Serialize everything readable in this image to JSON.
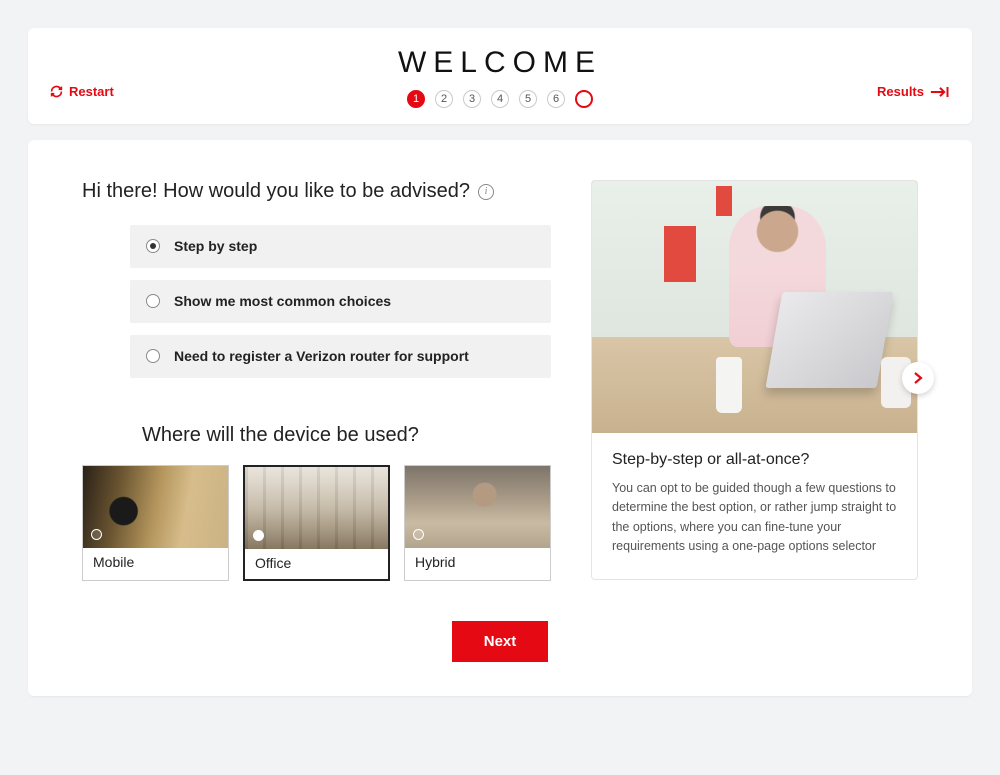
{
  "colors": {
    "accent": "#e50914"
  },
  "header": {
    "title": "WELCOME",
    "restart_label": "Restart",
    "results_label": "Results",
    "steps": [
      "1",
      "2",
      "3",
      "4",
      "5",
      "6"
    ],
    "active_step_index": 0
  },
  "q1": {
    "title": "Hi there! How would you like to be advised?",
    "options": [
      {
        "label": "Step by step",
        "selected": true
      },
      {
        "label": "Show me most common choices",
        "selected": false
      },
      {
        "label": "Need to register a Verizon router for support",
        "selected": false
      }
    ]
  },
  "q2": {
    "title": "Where will the device be used?",
    "tiles": [
      {
        "label": "Mobile",
        "selected": false,
        "image": "mobile-device-photo"
      },
      {
        "label": "Office",
        "selected": true,
        "image": "office-workspace-photo"
      },
      {
        "label": "Hybrid",
        "selected": false,
        "image": "hybrid-work-photo"
      }
    ]
  },
  "info_panel": {
    "image": "man-at-desk-with-laptop-photo",
    "title": "Step-by-step or all-at-once?",
    "text": "You can opt to be guided though a few questions to determine the best option, or rather jump straight to the options, where you can fine-tune your requirements using a one-page options selector"
  },
  "next_label": "Next"
}
